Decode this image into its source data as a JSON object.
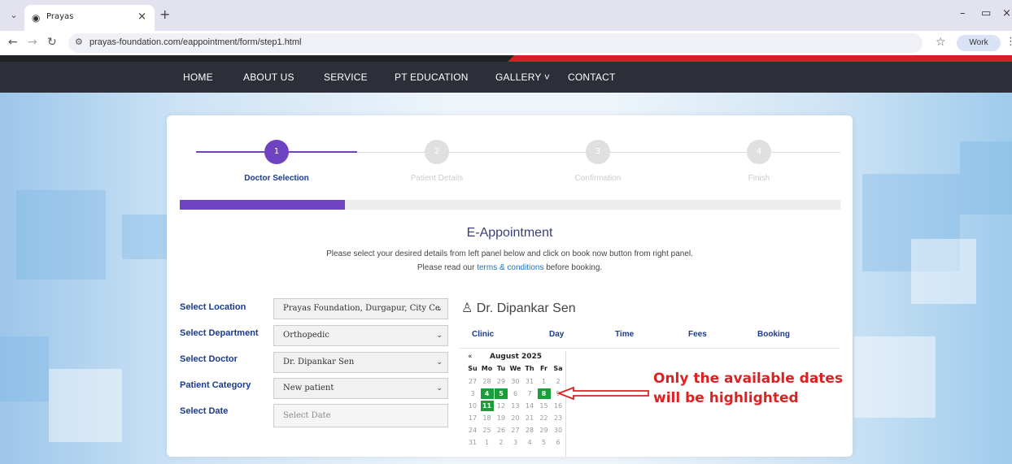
{
  "browser": {
    "tab_title": "Prayas",
    "url": "prayas-foundation.com/eappointment/form/step1.html",
    "profile": "Work"
  },
  "nav": {
    "items": [
      "HOME",
      "ABOUT US",
      "SERVICE",
      "PT EDUCATION",
      "GALLERY ˅",
      "CONTACT"
    ]
  },
  "steps": [
    {
      "num": "1",
      "label": "Doctor Selection",
      "active": true
    },
    {
      "num": "2",
      "label": "Patient Details",
      "active": false
    },
    {
      "num": "3",
      "label": "Confirmation",
      "active": false
    },
    {
      "num": "4",
      "label": "Finish",
      "active": false
    }
  ],
  "progress_fraction": 0.25,
  "form": {
    "title": "E-Appointment",
    "desc_line1": "Please select your desired details from left panel below and click on book now button from right panel.",
    "desc_line2_prefix": "Please read our ",
    "desc_line2_link": "terms & conditions",
    "desc_line2_suffix": " before booking.",
    "fields": [
      {
        "label": "Select Location",
        "value": "Prayas Foundation, Durgapur, City Ce"
      },
      {
        "label": "Select Department",
        "value": "Orthopedic"
      },
      {
        "label": "Select Doctor",
        "value": "Dr. Dipankar Sen"
      },
      {
        "label": "Patient Category",
        "value": "New patient"
      },
      {
        "label": "Select Date",
        "placeholder": "Select Date"
      }
    ]
  },
  "doctor": {
    "name": "Dr. Dipankar Sen",
    "columns": [
      "Clinic",
      "Day",
      "Time",
      "Fees",
      "Booking"
    ]
  },
  "calendar": {
    "prev": "«",
    "month": "August 2025",
    "dow": [
      "Su",
      "Mo",
      "Tu",
      "We",
      "Th",
      "Fr",
      "Sa"
    ],
    "weeks": [
      [
        "27",
        "28",
        "29",
        "30",
        "31",
        "1",
        "2"
      ],
      [
        "3",
        "4",
        "5",
        "6",
        "7",
        "8",
        "9"
      ],
      [
        "10",
        "11",
        "12",
        "13",
        "14",
        "15",
        "16"
      ],
      [
        "17",
        "18",
        "19",
        "20",
        "21",
        "22",
        "23"
      ],
      [
        "24",
        "25",
        "26",
        "27",
        "28",
        "29",
        "30"
      ],
      [
        "31",
        "1",
        "2",
        "3",
        "4",
        "5",
        "6"
      ]
    ],
    "available": [
      "4",
      "5",
      "8",
      "11"
    ]
  },
  "annotation": {
    "line1": "Only the available dates",
    "line2": "will be highlighted",
    "color": "#e02020"
  },
  "colors": {
    "accent": "#6f42c1",
    "navbar": "#2c2f38",
    "available": "#1a9e3a"
  }
}
